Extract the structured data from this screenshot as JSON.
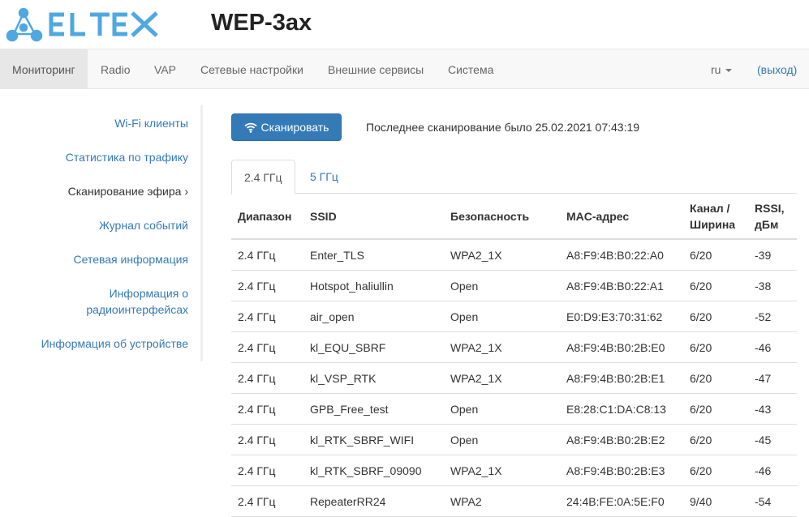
{
  "brand": {
    "name": "ELTEX",
    "color": "#4fa8e0"
  },
  "device": {
    "title": "WEP-3ax"
  },
  "nav": {
    "items": [
      {
        "label": "Мониторинг",
        "active": true
      },
      {
        "label": "Radio"
      },
      {
        "label": "VAP"
      },
      {
        "label": "Сетевые настройки"
      },
      {
        "label": "Внешние сервисы"
      },
      {
        "label": "Система"
      }
    ],
    "lang": "ru",
    "logout": "(выход)"
  },
  "sidebar": {
    "items": [
      {
        "label": "Wi-Fi клиенты"
      },
      {
        "label": "Статистика по трафику"
      },
      {
        "label": "Сканирование эфира ›",
        "active": true
      },
      {
        "label": "Журнал событий"
      },
      {
        "label": "Сетевая информация"
      },
      {
        "label": "Информация о",
        "label2": "радиоинтерфейсах"
      },
      {
        "label": "Информация об устройстве"
      }
    ]
  },
  "scan": {
    "button_label": "Сканировать",
    "icon": "wifi-icon",
    "last_scan": "Последнее сканирование было 25.02.2021 07:43:19"
  },
  "tabs": [
    {
      "label": "2.4 ГГц",
      "active": true
    },
    {
      "label": "5 ГГц"
    }
  ],
  "table": {
    "headers": [
      "Диапазон",
      "SSID",
      "Безопасность",
      "MAC-адрес",
      "Канал /",
      "RSSI,"
    ],
    "headers2": [
      "",
      "",
      "",
      "",
      "Ширина",
      "дБм"
    ],
    "rows": [
      [
        "2.4 ГГц",
        "Enter_TLS",
        "WPA2_1X",
        "A8:F9:4B:B0:22:A0",
        "6/20",
        "-39"
      ],
      [
        "2.4 ГГц",
        "Hotspot_haliullin",
        "Open",
        "A8:F9:4B:B0:22:A1",
        "6/20",
        "-38"
      ],
      [
        "2.4 ГГц",
        "air_open",
        "Open",
        "E0:D9:E3:70:31:62",
        "6/20",
        "-52"
      ],
      [
        "2.4 ГГц",
        "kl_EQU_SBRF",
        "WPA2_1X",
        "A8:F9:4B:B0:2B:E0",
        "6/20",
        "-46"
      ],
      [
        "2.4 ГГц",
        "kl_VSP_RTK",
        "WPA2_1X",
        "A8:F9:4B:B0:2B:E1",
        "6/20",
        "-47"
      ],
      [
        "2.4 ГГц",
        "GPB_Free_test",
        "Open",
        "E8:28:C1:DA:C8:13",
        "6/20",
        "-43"
      ],
      [
        "2.4 ГГц",
        "kl_RTK_SBRF_WIFI",
        "Open",
        "A8:F9:4B:B0:2B:E2",
        "6/20",
        "-45"
      ],
      [
        "2.4 ГГц",
        "kl_RTK_SBRF_09090",
        "WPA2_1X",
        "A8:F9:4B:B0:2B:E3",
        "6/20",
        "-46"
      ],
      [
        "2.4 ГГц",
        "RepeaterRR24",
        "WPA2",
        "24:4B:FE:0A:5E:F0",
        "9/40",
        "-54"
      ]
    ]
  }
}
